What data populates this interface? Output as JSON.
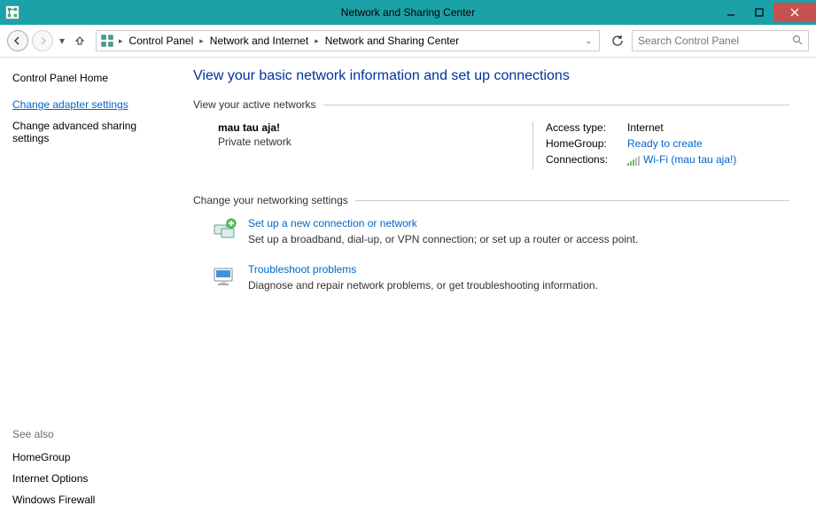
{
  "titlebar": {
    "title": "Network and Sharing Center"
  },
  "breadcrumb": {
    "items": [
      "Control Panel",
      "Network and Internet",
      "Network and Sharing Center"
    ]
  },
  "search": {
    "placeholder": "Search Control Panel"
  },
  "sidebar": {
    "home": "Control Panel Home",
    "links": [
      {
        "label": "Change adapter settings",
        "current": true
      },
      {
        "label": "Change advanced sharing settings",
        "current": false
      }
    ],
    "seealso_title": "See also",
    "seealso": [
      "HomeGroup",
      "Internet Options",
      "Windows Firewall"
    ]
  },
  "main": {
    "heading": "View your basic network information and set up connections",
    "active_networks_label": "View your active networks",
    "network": {
      "name": "mau tau aja!",
      "type": "Private network",
      "access_type_label": "Access type:",
      "access_type_value": "Internet",
      "homegroup_label": "HomeGroup:",
      "homegroup_value": "Ready to create",
      "connections_label": "Connections:",
      "connections_value": "Wi-Fi (mau tau aja!)"
    },
    "change_settings_label": "Change your networking settings",
    "settings": [
      {
        "title": "Set up a new connection or network",
        "desc": "Set up a broadband, dial-up, or VPN connection; or set up a router or access point."
      },
      {
        "title": "Troubleshoot problems",
        "desc": "Diagnose and repair network problems, or get troubleshooting information."
      }
    ]
  }
}
